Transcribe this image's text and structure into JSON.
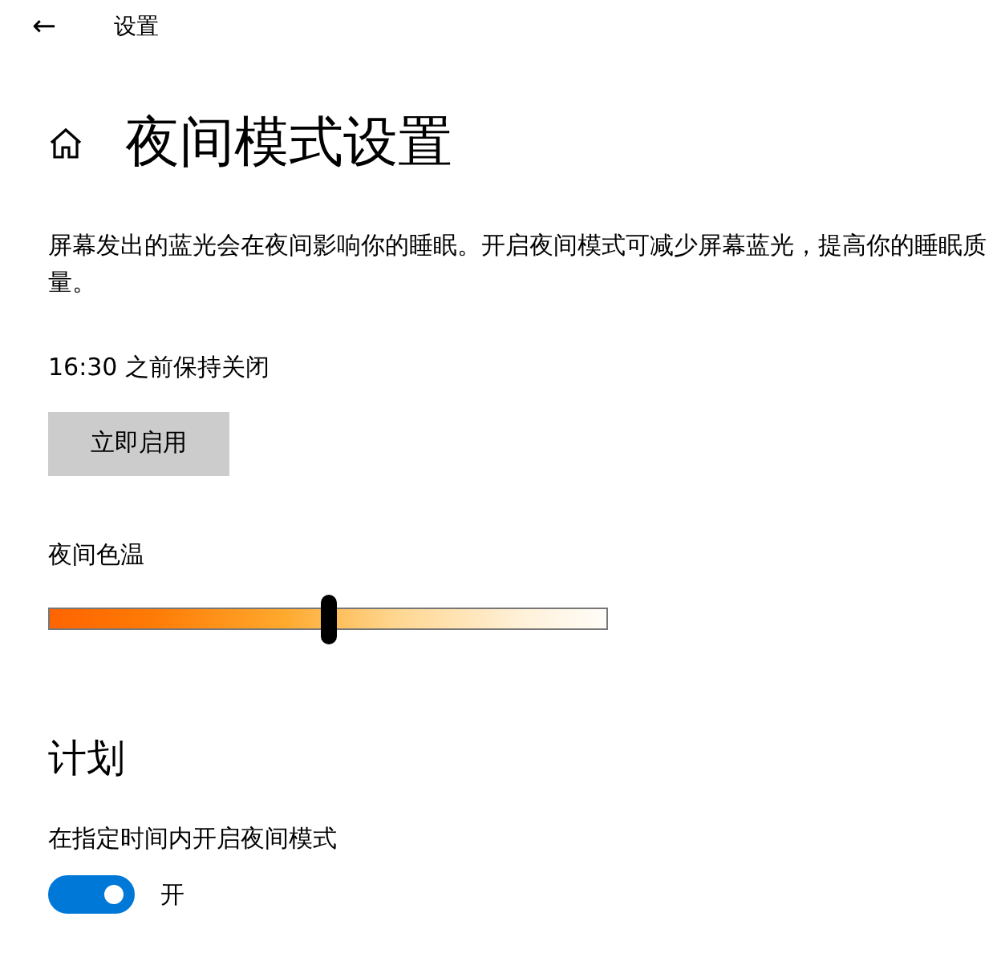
{
  "header": {
    "back": "←",
    "title": "设置"
  },
  "page_title": "夜间模式设置",
  "description": "屏幕发出的蓝光会在夜间影响你的睡眠。开启夜间模式可减少屏幕蓝光，提高你的睡眠质量。",
  "status": "16:30 之前保持关闭",
  "enable_button": "立即启用",
  "color_temperature": {
    "label": "夜间色温",
    "level": 0.5
  },
  "schedule": {
    "heading": "计划",
    "label": "在指定时间内开启夜间模式",
    "on": true,
    "state_text": "开"
  }
}
